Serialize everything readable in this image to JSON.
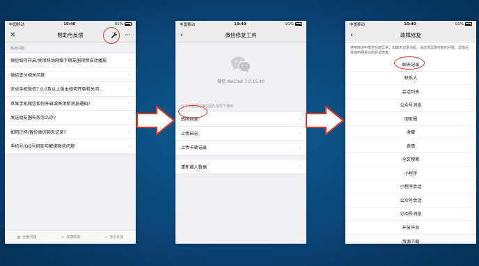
{
  "status": {
    "carrier": "中国移动",
    "time": "10:40",
    "battery": "91%"
  },
  "phone1": {
    "title": "帮助与反馈",
    "section": "热点问题",
    "items": [
      "微信如何开启/关闭移动网络下朋友圈视频自动播放",
      "微信支付相关问题",
      "安卓手机微信7.0.0及以上版本如何开启和关闭...",
      "苹果手机微信如何开启或关闭新消息通知?",
      "发送朋友圈失败怎么办?",
      "如何迁移/备份微信聊天记录?",
      "手机号/QQ号绑定与解绑微信问题"
    ],
    "bottom": [
      "全部问题",
      "快捷帮助",
      "意见反馈"
    ]
  },
  "phone2": {
    "title": "微信修复工具",
    "version": "微信 WeChat 7.0.15.40",
    "hint": "以下功能请在微信团队指导下使用",
    "group1": [
      "故障修复",
      "上传日志",
      "上传卡顿记录"
    ],
    "group2": [
      "重新载入数据"
    ]
  },
  "phone3": {
    "title": "故障修复",
    "description": "使用微信中发生功能异常，如聊天记录混乱，请选择需要修复的问题，选择后将使用相关功能尝试修复。",
    "items": [
      "聊天记录",
      "联系人",
      "会话列表",
      "公众号消息",
      "朋友圈",
      "收藏",
      "表情",
      "全文搜索",
      "小程序",
      "小程序会话",
      "公众号会话",
      "订阅号消息",
      "开放平台",
      "资源下载"
    ]
  },
  "colors": {
    "annotation": "#e32",
    "arrow_fill": "#ffffff",
    "arrow_stroke": "#d43a2c",
    "wechat_logo": "#cfcfcf"
  }
}
